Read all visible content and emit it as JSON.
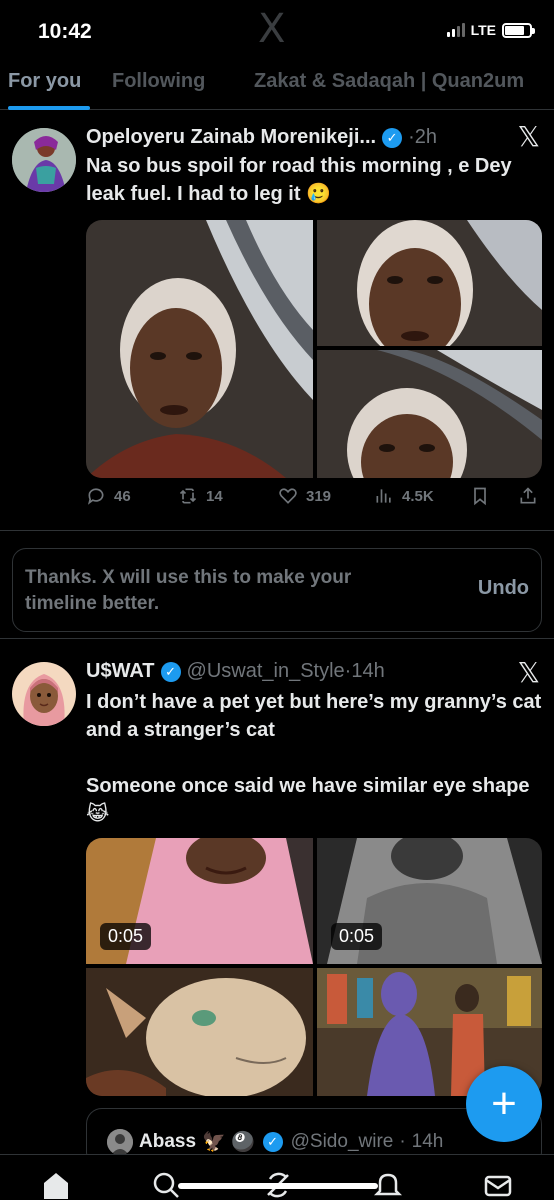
{
  "status_bar": {
    "time": "10:42",
    "network": "LTE",
    "logo": "X"
  },
  "tabs": [
    {
      "label": "For you",
      "active": true
    },
    {
      "label": "Following",
      "active": false
    },
    {
      "label": "Zakat & Sadaqah | Quan2um",
      "active": false
    }
  ],
  "tweet1": {
    "name": "Opeloyeru Zainab Morenikeji...",
    "verified": true,
    "time": "2h",
    "text": "Na so bus spoil for road this morning , e Dey leak fuel. I had to leg it 🥲",
    "media_count": 3,
    "stats": {
      "replies": "46",
      "reposts": "14",
      "likes": "319",
      "views": "4.5K"
    }
  },
  "feedback_notice": {
    "text": "Thanks. X will use this to make your timeline better.",
    "undo_label": "Undo"
  },
  "tweet2": {
    "name": "U$WAT",
    "verified": true,
    "handle": "@Uswat_in_Style",
    "time": "14h",
    "text": "I don’t have a pet yet but here’s my granny’s cat and a stranger’s cat\n\nSomeone once said we have similar eye shape 😹",
    "video_durations": [
      "0:05",
      "0:05"
    ]
  },
  "quoted_tweet": {
    "name": "Abass",
    "emoji": "🦅 🎱",
    "verified": true,
    "handle": "@Sido_wire",
    "time": "14h"
  },
  "fab": {
    "icon": "plus-icon",
    "label": "+"
  },
  "colors": {
    "accent": "#1d9bf0",
    "background": "#000000",
    "muted": "#71767b"
  }
}
